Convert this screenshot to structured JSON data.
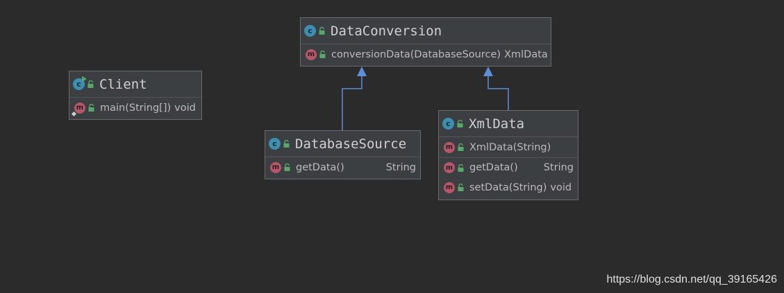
{
  "classes": {
    "data_conversion": {
      "name": "DataConversion",
      "methods": [
        {
          "name": "conversionData(DatabaseSource)",
          "type": "XmlData"
        }
      ]
    },
    "client": {
      "name": "Client",
      "methods": [
        {
          "name": "main(String[])",
          "type": "void"
        }
      ]
    },
    "database_source": {
      "name": "DatabaseSource",
      "methods": [
        {
          "name": "getData()",
          "type": "String"
        }
      ]
    },
    "xml_data": {
      "name": "XmlData",
      "constructors": [
        {
          "name": "XmlData(String)"
        }
      ],
      "methods": [
        {
          "name": "getData()",
          "type": "String"
        },
        {
          "name": "setData(String)",
          "type": "void"
        }
      ]
    }
  },
  "relations": [
    {
      "from": "DatabaseSource",
      "to": "DataConversion",
      "kind": "realization"
    },
    {
      "from": "XmlData",
      "to": "DataConversion",
      "kind": "realization"
    }
  ],
  "colors": {
    "background": "#2b2b2b",
    "node_fill": "#3c3f41",
    "class_icon": "#3c8fb0",
    "method_icon": "#b4576b",
    "public_lock": "#59a869",
    "edge": "#5c8fd6"
  },
  "icons": {
    "class": "class-icon",
    "method": "method-icon",
    "visibility": "lock-icon"
  },
  "watermark": "https://blog.csdn.net/qq_39165426"
}
